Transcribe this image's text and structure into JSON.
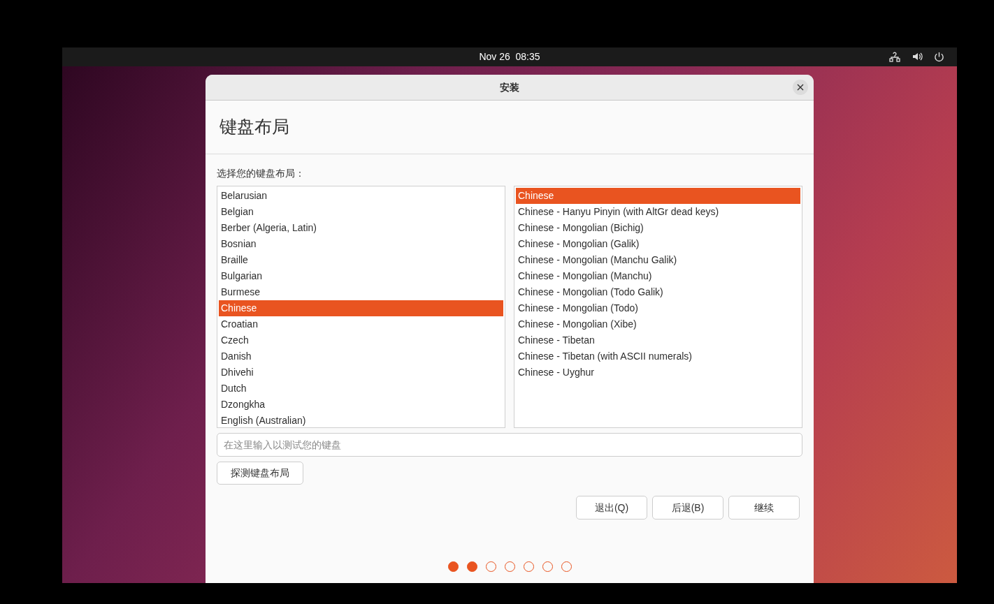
{
  "top_bar": {
    "datetime": "Nov 26  08:35"
  },
  "window": {
    "title": "安装"
  },
  "page": {
    "heading": "键盘布局",
    "prompt": "选择您的键盘布局："
  },
  "layouts": [
    {
      "label": "Belarusian",
      "selected": false
    },
    {
      "label": "Belgian",
      "selected": false
    },
    {
      "label": "Berber (Algeria, Latin)",
      "selected": false
    },
    {
      "label": "Bosnian",
      "selected": false
    },
    {
      "label": "Braille",
      "selected": false
    },
    {
      "label": "Bulgarian",
      "selected": false
    },
    {
      "label": "Burmese",
      "selected": false
    },
    {
      "label": "Chinese",
      "selected": true
    },
    {
      "label": "Croatian",
      "selected": false
    },
    {
      "label": "Czech",
      "selected": false
    },
    {
      "label": "Danish",
      "selected": false
    },
    {
      "label": "Dhivehi",
      "selected": false
    },
    {
      "label": "Dutch",
      "selected": false
    },
    {
      "label": "Dzongkha",
      "selected": false
    },
    {
      "label": "English (Australian)",
      "selected": false
    }
  ],
  "variants": [
    {
      "label": "Chinese",
      "selected": true
    },
    {
      "label": "Chinese - Hanyu Pinyin (with AltGr dead keys)",
      "selected": false
    },
    {
      "label": "Chinese - Mongolian (Bichig)",
      "selected": false
    },
    {
      "label": "Chinese - Mongolian (Galik)",
      "selected": false
    },
    {
      "label": "Chinese - Mongolian (Manchu Galik)",
      "selected": false
    },
    {
      "label": "Chinese - Mongolian (Manchu)",
      "selected": false
    },
    {
      "label": "Chinese - Mongolian (Todo Galik)",
      "selected": false
    },
    {
      "label": "Chinese - Mongolian (Todo)",
      "selected": false
    },
    {
      "label": "Chinese - Mongolian (Xibe)",
      "selected": false
    },
    {
      "label": "Chinese - Tibetan",
      "selected": false
    },
    {
      "label": "Chinese - Tibetan (with ASCII numerals)",
      "selected": false
    },
    {
      "label": "Chinese - Uyghur",
      "selected": false
    }
  ],
  "test_field": {
    "placeholder": "在这里输入以测试您的键盘"
  },
  "detect_button": "探测键盘布局",
  "buttons": [
    "退出(Q)",
    "后退(B)",
    "继续"
  ],
  "steps": [
    {
      "filled": true
    },
    {
      "filled": true
    },
    {
      "filled": false
    },
    {
      "filled": false
    },
    {
      "filled": false
    },
    {
      "filled": false
    },
    {
      "filled": false
    }
  ]
}
